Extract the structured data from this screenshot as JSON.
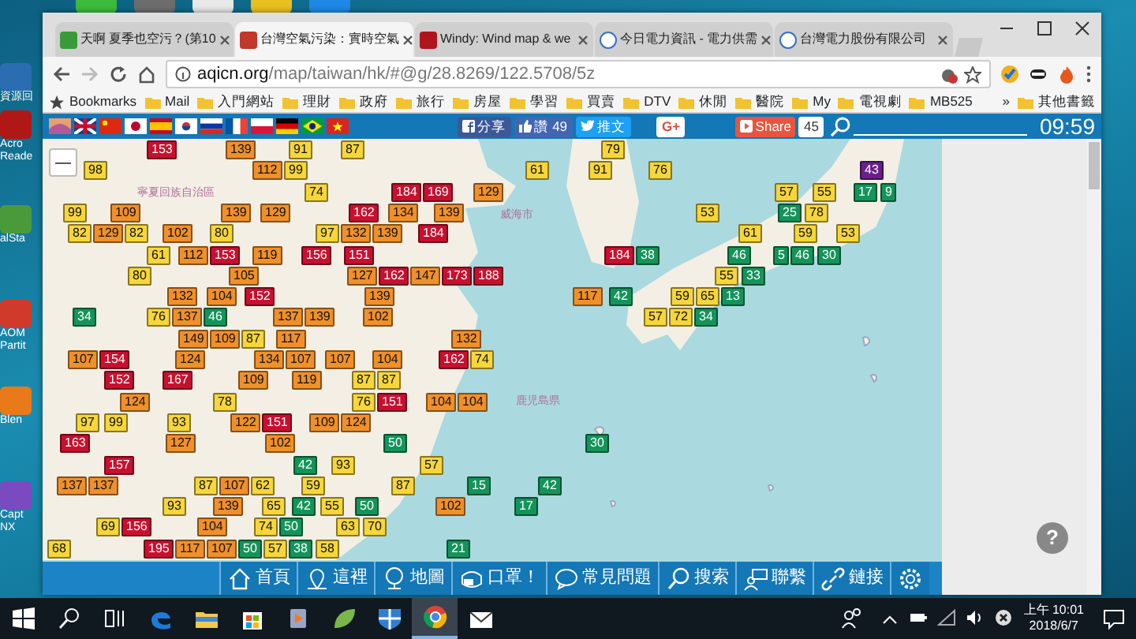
{
  "desktop_icons": [
    {
      "label": "資源回"
    },
    {
      "label": "Acro Reade"
    },
    {
      "label": "alSta"
    },
    {
      "label": "AOM Partit"
    },
    {
      "label": "Blen"
    },
    {
      "label": "Capt NX"
    }
  ],
  "tabs": [
    {
      "title": "天啊 夏季也空污？(第10",
      "selected": false
    },
    {
      "title": "台灣空氣污染：實時空氣",
      "selected": true
    },
    {
      "title": "Windy: Wind map & we",
      "selected": false
    },
    {
      "title": "今日電力資訊 - 電力供需",
      "selected": false
    },
    {
      "title": "台灣電力股份有限公司",
      "selected": false
    }
  ],
  "address": {
    "host": "aqicn.org",
    "path": "/map/taiwan/hk/#@g/28.8269/122.5708/5z"
  },
  "bookmarks": [
    {
      "label": "Bookmarks",
      "kind": "star"
    },
    {
      "label": "Mail",
      "kind": "folder"
    },
    {
      "label": "入門網站",
      "kind": "folder"
    },
    {
      "label": "理財",
      "kind": "folder"
    },
    {
      "label": "政府",
      "kind": "folder"
    },
    {
      "label": "旅行",
      "kind": "folder"
    },
    {
      "label": "房屋",
      "kind": "folder"
    },
    {
      "label": "學習",
      "kind": "folder"
    },
    {
      "label": "買賣",
      "kind": "folder"
    },
    {
      "label": "DTV",
      "kind": "folder"
    },
    {
      "label": "休閒",
      "kind": "folder"
    },
    {
      "label": "醫院",
      "kind": "folder"
    },
    {
      "label": "My",
      "kind": "folder"
    },
    {
      "label": "電視劇",
      "kind": "folder"
    },
    {
      "label": "MB525",
      "kind": "folder"
    },
    {
      "label": "»",
      "kind": "more"
    },
    {
      "label": "其他書籤",
      "kind": "folder"
    }
  ],
  "site_bar": {
    "facebook_share": "分享",
    "like": "讚 49",
    "tweet": "推文",
    "gplus": "G+",
    "share": "Share",
    "share_count": "45",
    "clock": "09:59"
  },
  "map": {
    "zoom_out": "—",
    "place_names": [
      "寧夏回族自治區",
      "威海市",
      "鹿児島県"
    ],
    "markers": [
      {
        "value": "153",
        "color": "#c8102e"
      },
      {
        "value": "139",
        "color": "#f0902a"
      },
      {
        "value": "91",
        "color": "#f6d63a"
      },
      {
        "value": "87",
        "color": "#f6d63a"
      },
      {
        "value": "79",
        "color": "#f6d63a"
      },
      {
        "value": "98",
        "color": "#f6d63a"
      },
      {
        "value": "112",
        "color": "#f0902a"
      },
      {
        "value": "99",
        "color": "#f6d63a"
      },
      {
        "value": "61",
        "color": "#f6d63a"
      },
      {
        "value": "91",
        "color": "#f6d63a"
      },
      {
        "value": "76",
        "color": "#f6d63a"
      },
      {
        "value": "43",
        "color": "#6b1f8a"
      },
      {
        "value": "74",
        "color": "#f6d63a"
      },
      {
        "value": "184",
        "color": "#c8102e"
      },
      {
        "value": "169",
        "color": "#c8102e"
      },
      {
        "value": "129",
        "color": "#f0902a"
      },
      {
        "value": "57",
        "color": "#f6d63a"
      },
      {
        "value": "55",
        "color": "#f6d63a"
      },
      {
        "value": "17",
        "color": "#13945a"
      },
      {
        "value": "9",
        "color": "#13945a"
      },
      {
        "value": "99",
        "color": "#f6d63a"
      },
      {
        "value": "109",
        "color": "#f0902a"
      },
      {
        "value": "139",
        "color": "#f0902a"
      },
      {
        "value": "129",
        "color": "#f0902a"
      },
      {
        "value": "162",
        "color": "#c8102e"
      },
      {
        "value": "134",
        "color": "#f0902a"
      },
      {
        "value": "139",
        "color": "#f0902a"
      },
      {
        "value": "53",
        "color": "#f6d63a"
      },
      {
        "value": "25",
        "color": "#13945a"
      },
      {
        "value": "78",
        "color": "#f6d63a"
      },
      {
        "value": "82",
        "color": "#f6d63a"
      },
      {
        "value": "129",
        "color": "#f0902a"
      },
      {
        "value": "82",
        "color": "#f6d63a"
      },
      {
        "value": "102",
        "color": "#f0902a"
      },
      {
        "value": "80",
        "color": "#f6d63a"
      },
      {
        "value": "97",
        "color": "#f6d63a"
      },
      {
        "value": "132",
        "color": "#f0902a"
      },
      {
        "value": "139",
        "color": "#f0902a"
      },
      {
        "value": "184",
        "color": "#c8102e"
      },
      {
        "value": "61",
        "color": "#f6d63a"
      },
      {
        "value": "59",
        "color": "#f6d63a"
      },
      {
        "value": "53",
        "color": "#f6d63a"
      },
      {
        "value": "61",
        "color": "#f6d63a"
      },
      {
        "value": "112",
        "color": "#f0902a"
      },
      {
        "value": "153",
        "color": "#c8102e"
      },
      {
        "value": "119",
        "color": "#f0902a"
      },
      {
        "value": "156",
        "color": "#c8102e"
      },
      {
        "value": "151",
        "color": "#c8102e"
      },
      {
        "value": "184",
        "color": "#c8102e"
      },
      {
        "value": "38",
        "color": "#13945a"
      },
      {
        "value": "46",
        "color": "#13945a"
      },
      {
        "value": "5",
        "color": "#13945a"
      },
      {
        "value": "46",
        "color": "#13945a"
      },
      {
        "value": "30",
        "color": "#13945a"
      },
      {
        "value": "80",
        "color": "#f6d63a"
      },
      {
        "value": "105",
        "color": "#f0902a"
      },
      {
        "value": "127",
        "color": "#f0902a"
      },
      {
        "value": "162",
        "color": "#c8102e"
      },
      {
        "value": "147",
        "color": "#f0902a"
      },
      {
        "value": "173",
        "color": "#c8102e"
      },
      {
        "value": "188",
        "color": "#c8102e"
      },
      {
        "value": "55",
        "color": "#f6d63a"
      },
      {
        "value": "33",
        "color": "#13945a"
      },
      {
        "value": "132",
        "color": "#f0902a"
      },
      {
        "value": "104",
        "color": "#f0902a"
      },
      {
        "value": "152",
        "color": "#c8102e"
      },
      {
        "value": "139",
        "color": "#f0902a"
      },
      {
        "value": "117",
        "color": "#f0902a"
      },
      {
        "value": "42",
        "color": "#13945a"
      },
      {
        "value": "59",
        "color": "#f6d63a"
      },
      {
        "value": "65",
        "color": "#f6d63a"
      },
      {
        "value": "13",
        "color": "#13945a"
      },
      {
        "value": "34",
        "color": "#13945a"
      },
      {
        "value": "76",
        "color": "#f6d63a"
      },
      {
        "value": "137",
        "color": "#f0902a"
      },
      {
        "value": "46",
        "color": "#13945a"
      },
      {
        "value": "137",
        "color": "#f0902a"
      },
      {
        "value": "139",
        "color": "#f0902a"
      },
      {
        "value": "102",
        "color": "#f0902a"
      },
      {
        "value": "57",
        "color": "#f6d63a"
      },
      {
        "value": "72",
        "color": "#f6d63a"
      },
      {
        "value": "34",
        "color": "#13945a"
      },
      {
        "value": "149",
        "color": "#f0902a"
      },
      {
        "value": "109",
        "color": "#f0902a"
      },
      {
        "value": "87",
        "color": "#f6d63a"
      },
      {
        "value": "117",
        "color": "#f0902a"
      },
      {
        "value": "132",
        "color": "#f0902a"
      },
      {
        "value": "107",
        "color": "#f0902a"
      },
      {
        "value": "154",
        "color": "#c8102e"
      },
      {
        "value": "124",
        "color": "#f0902a"
      },
      {
        "value": "134",
        "color": "#f0902a"
      },
      {
        "value": "107",
        "color": "#f0902a"
      },
      {
        "value": "107",
        "color": "#f0902a"
      },
      {
        "value": "104",
        "color": "#f0902a"
      },
      {
        "value": "162",
        "color": "#c8102e"
      },
      {
        "value": "74",
        "color": "#f6d63a"
      },
      {
        "value": "152",
        "color": "#c8102e"
      },
      {
        "value": "167",
        "color": "#c8102e"
      },
      {
        "value": "109",
        "color": "#f0902a"
      },
      {
        "value": "119",
        "color": "#f0902a"
      },
      {
        "value": "87",
        "color": "#f6d63a"
      },
      {
        "value": "87",
        "color": "#f6d63a"
      },
      {
        "value": "124",
        "color": "#f0902a"
      },
      {
        "value": "78",
        "color": "#f6d63a"
      },
      {
        "value": "76",
        "color": "#f6d63a"
      },
      {
        "value": "151",
        "color": "#c8102e"
      },
      {
        "value": "104",
        "color": "#f0902a"
      },
      {
        "value": "104",
        "color": "#f0902a"
      },
      {
        "value": "97",
        "color": "#f6d63a"
      },
      {
        "value": "99",
        "color": "#f6d63a"
      },
      {
        "value": "93",
        "color": "#f6d63a"
      },
      {
        "value": "122",
        "color": "#f0902a"
      },
      {
        "value": "151",
        "color": "#c8102e"
      },
      {
        "value": "109",
        "color": "#f0902a"
      },
      {
        "value": "124",
        "color": "#f0902a"
      },
      {
        "value": "163",
        "color": "#c8102e"
      },
      {
        "value": "127",
        "color": "#f0902a"
      },
      {
        "value": "102",
        "color": "#f0902a"
      },
      {
        "value": "50",
        "color": "#13945a"
      },
      {
        "value": "30",
        "color": "#13945a"
      },
      {
        "value": "157",
        "color": "#c8102e"
      },
      {
        "value": "42",
        "color": "#13945a"
      },
      {
        "value": "93",
        "color": "#f6d63a"
      },
      {
        "value": "57",
        "color": "#f6d63a"
      },
      {
        "value": "137",
        "color": "#f0902a"
      },
      {
        "value": "137",
        "color": "#f0902a"
      },
      {
        "value": "87",
        "color": "#f6d63a"
      },
      {
        "value": "107",
        "color": "#f0902a"
      },
      {
        "value": "62",
        "color": "#f6d63a"
      },
      {
        "value": "59",
        "color": "#f6d63a"
      },
      {
        "value": "87",
        "color": "#f6d63a"
      },
      {
        "value": "15",
        "color": "#13945a"
      },
      {
        "value": "42",
        "color": "#13945a"
      },
      {
        "value": "93",
        "color": "#f6d63a"
      },
      {
        "value": "139",
        "color": "#f0902a"
      },
      {
        "value": "65",
        "color": "#f6d63a"
      },
      {
        "value": "42",
        "color": "#13945a"
      },
      {
        "value": "55",
        "color": "#f6d63a"
      },
      {
        "value": "50",
        "color": "#13945a"
      },
      {
        "value": "102",
        "color": "#f0902a"
      },
      {
        "value": "17",
        "color": "#13945a"
      },
      {
        "value": "69",
        "color": "#f6d63a"
      },
      {
        "value": "156",
        "color": "#c8102e"
      },
      {
        "value": "104",
        "color": "#f0902a"
      },
      {
        "value": "74",
        "color": "#f6d63a"
      },
      {
        "value": "50",
        "color": "#13945a"
      },
      {
        "value": "63",
        "color": "#f6d63a"
      },
      {
        "value": "70",
        "color": "#f6d63a"
      },
      {
        "value": "68",
        "color": "#f6d63a"
      },
      {
        "value": "195",
        "color": "#c8102e"
      },
      {
        "value": "117",
        "color": "#f0902a"
      },
      {
        "value": "107",
        "color": "#f0902a"
      },
      {
        "value": "50",
        "color": "#13945a"
      },
      {
        "value": "57",
        "color": "#f6d63a"
      },
      {
        "value": "38",
        "color": "#13945a"
      },
      {
        "value": "58",
        "color": "#f6d63a"
      },
      {
        "value": "21",
        "color": "#13945a"
      }
    ],
    "help": "?"
  },
  "bottom_nav": [
    {
      "label": "首頁"
    },
    {
      "label": "這裡"
    },
    {
      "label": "地圖"
    },
    {
      "label": "口罩！"
    },
    {
      "label": "常見問題"
    },
    {
      "label": "搜索"
    },
    {
      "label": "聯繫"
    },
    {
      "label": "鏈接"
    }
  ],
  "taskbar": {
    "apps": [
      {
        "selected": false
      },
      {
        "selected": false
      },
      {
        "selected": false
      },
      {
        "selected": false
      },
      {
        "selected": false
      },
      {
        "selected": false
      },
      {
        "selected": true
      },
      {
        "selected": false
      }
    ],
    "time": "上午 10:01",
    "date": "2018/6/7"
  }
}
